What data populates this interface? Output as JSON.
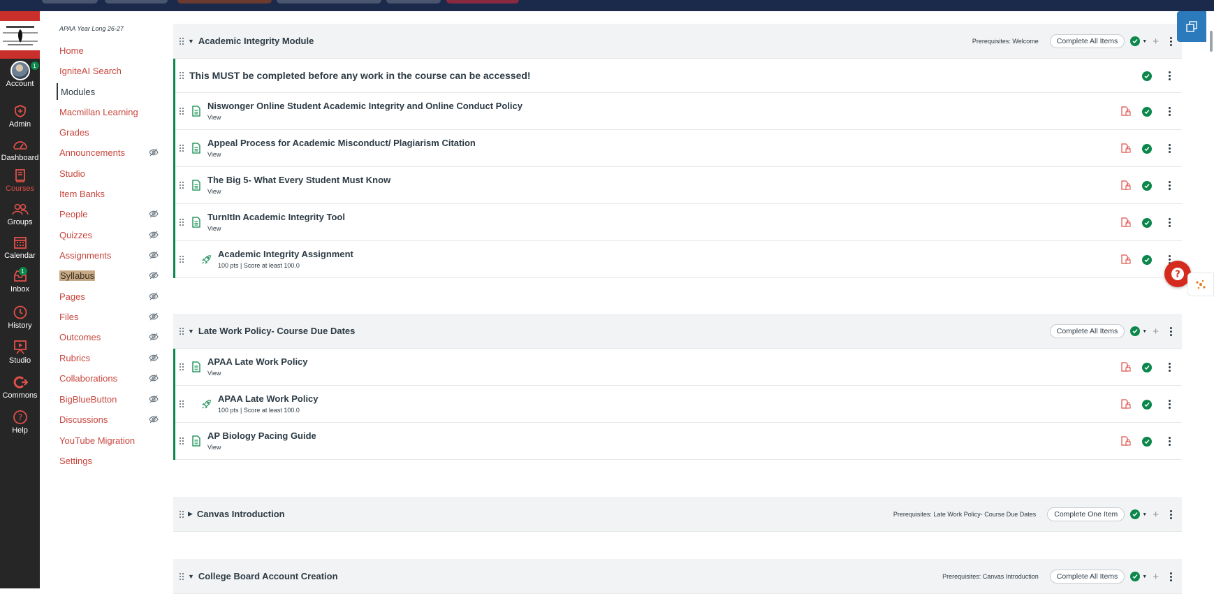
{
  "course_nav": {
    "term": "APAA Year Long 26-27",
    "items": [
      {
        "label": "Home",
        "hidden": false
      },
      {
        "label": "IgniteAI Search",
        "hidden": false
      },
      {
        "label": "Modules",
        "hidden": false,
        "active": true
      },
      {
        "label": "Macmillan Learning",
        "hidden": false
      },
      {
        "label": "Grades",
        "hidden": false
      },
      {
        "label": "Announcements",
        "hidden": true
      },
      {
        "label": "Studio",
        "hidden": false
      },
      {
        "label": "Item Banks",
        "hidden": false
      },
      {
        "label": "People",
        "hidden": true
      },
      {
        "label": "Quizzes",
        "hidden": true
      },
      {
        "label": "Assignments",
        "hidden": true
      },
      {
        "label": "Syllabus",
        "hidden": true,
        "highlighted": true
      },
      {
        "label": "Pages",
        "hidden": true
      },
      {
        "label": "Files",
        "hidden": true
      },
      {
        "label": "Outcomes",
        "hidden": true
      },
      {
        "label": "Rubrics",
        "hidden": true
      },
      {
        "label": "Collaborations",
        "hidden": true
      },
      {
        "label": "BigBlueButton",
        "hidden": true
      },
      {
        "label": "Discussions",
        "hidden": true
      },
      {
        "label": "YouTube Migration",
        "hidden": false
      },
      {
        "label": "Settings",
        "hidden": false
      }
    ]
  },
  "global_nav": {
    "items": [
      {
        "label": "Account",
        "icon": "avatar",
        "badge": "1"
      },
      {
        "label": "Admin",
        "icon": "shield-icon"
      },
      {
        "label": "Dashboard",
        "icon": "dashboard-icon"
      },
      {
        "label": "Courses",
        "icon": "courses-icon",
        "active": true
      },
      {
        "label": "Groups",
        "icon": "groups-icon"
      },
      {
        "label": "Calendar",
        "icon": "calendar-icon"
      },
      {
        "label": "Inbox",
        "icon": "inbox-icon",
        "badge": "1"
      },
      {
        "label": "History",
        "icon": "history-icon"
      },
      {
        "label": "Studio",
        "icon": "studio-icon"
      },
      {
        "label": "Commons",
        "icon": "commons-icon"
      },
      {
        "label": "Help",
        "icon": "help-icon"
      }
    ]
  },
  "modules": [
    {
      "title": "Academic Integrity Module",
      "prereq": "Prerequisites: Welcome",
      "requirement": "Complete All Items",
      "has_plus": true,
      "text_header": "This MUST be completed before any work in the course can be accessed!",
      "items": [
        {
          "title": "Niswonger Online Student Academic Integrity and Online Conduct Policy",
          "sub": "View",
          "type": "page"
        },
        {
          "title": "Appeal Process for Academic Misconduct/ Plagiarism Citation",
          "sub": "View",
          "type": "page"
        },
        {
          "title": "The Big 5- What Every Student Must Know",
          "sub": "View",
          "type": "page"
        },
        {
          "title": "TurnItIn Academic Integrity Tool",
          "sub": "View",
          "type": "page"
        },
        {
          "title": "Academic Integrity Assignment",
          "sub": "100 pts  |  Score at least 100.0",
          "type": "assignment"
        }
      ]
    },
    {
      "title": "Late Work Policy- Course Due Dates",
      "prereq": "",
      "requirement": "Complete All Items",
      "has_plus": true,
      "items": [
        {
          "title": "APAA Late Work Policy",
          "sub": "View",
          "type": "page"
        },
        {
          "title": "APAA Late Work Policy",
          "sub": "100 pts  |  Score at least 100.0",
          "type": "assignment"
        },
        {
          "title": "AP Biology Pacing Guide",
          "sub": "View",
          "type": "page"
        }
      ]
    },
    {
      "title": "Canvas Introduction",
      "prereq": "Prerequisites: Late Work Policy- Course Due Dates",
      "requirement": "Complete One Item",
      "has_plus": true,
      "collapsed": true
    },
    {
      "title": "College Board Account Creation",
      "prereq": "Prerequisites: Canvas Introduction",
      "requirement": "Complete All Items",
      "has_plus": true
    }
  ],
  "colors": {
    "link": "#c7453c",
    "success": "#0b874b",
    "nav_bg": "#262626",
    "brand_red": "#c9302c"
  }
}
